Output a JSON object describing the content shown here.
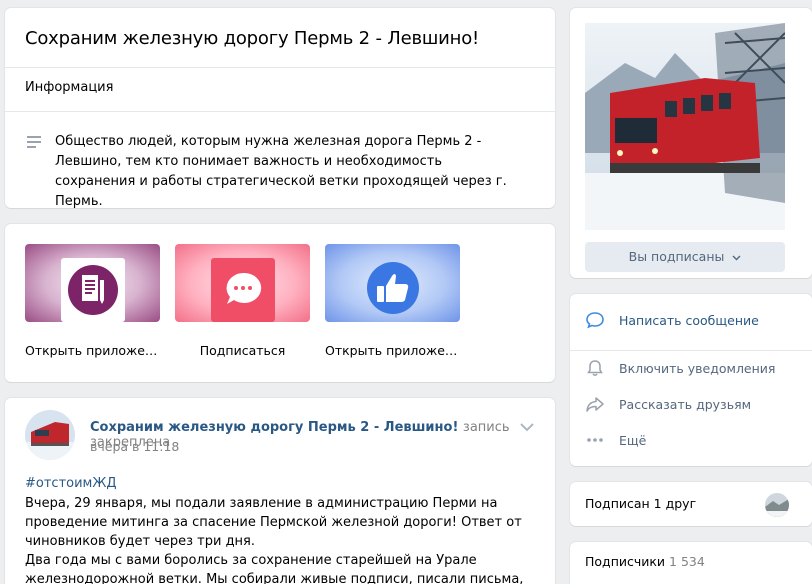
{
  "group": {
    "title": "Сохраним железную дорогу Пермь 2 - Левшино!",
    "info_label": "Информация",
    "description": "Общество людей, которым нужна железная дорога Пермь 2 - Левшино, тем кто понимает важность и необходимость сохранения и работы стратегической ветки проходящей через г. Пермь."
  },
  "apps": [
    {
      "label": "Открыть приложение",
      "icon": "document-pen-icon"
    },
    {
      "label": "Подписаться",
      "icon": "message-bubble-icon"
    },
    {
      "label": "Открыть приложение",
      "icon": "thumbs-up-icon"
    }
  ],
  "post": {
    "author": "Сохраним железную дорогу Пермь 2 - Левшино!",
    "pinned": "запись закреплена",
    "time": "вчера в 11:18",
    "hashtag": "#отстоимЖД",
    "body": "Вчера, 29 января, мы подали заявление в администрацию Перми на проведение митинга за спасение Пермской железной дороги! Ответ от чиновников будет через три дня.\nДва года мы с вами боролись за сохранение старейшей на Урале железнодорожной ветки. Мы собирали живые подписи, писали письма, выходили"
  },
  "sidebar": {
    "subscribed_button": "Вы подписаны",
    "actions": {
      "message": "Написать сообщение",
      "notify": "Включить уведомления",
      "share": "Рассказать друзьям",
      "more": "Ещё"
    },
    "friends_label": "Подписан 1 друг",
    "subscribers_label": "Подписчики",
    "subscribers_count": "1 534"
  },
  "colors": {
    "link": "#2a5885",
    "secondary": "#55677d",
    "muted": "#828282",
    "button_bg": "#e5ebf1",
    "page_bg": "#edeef0"
  }
}
